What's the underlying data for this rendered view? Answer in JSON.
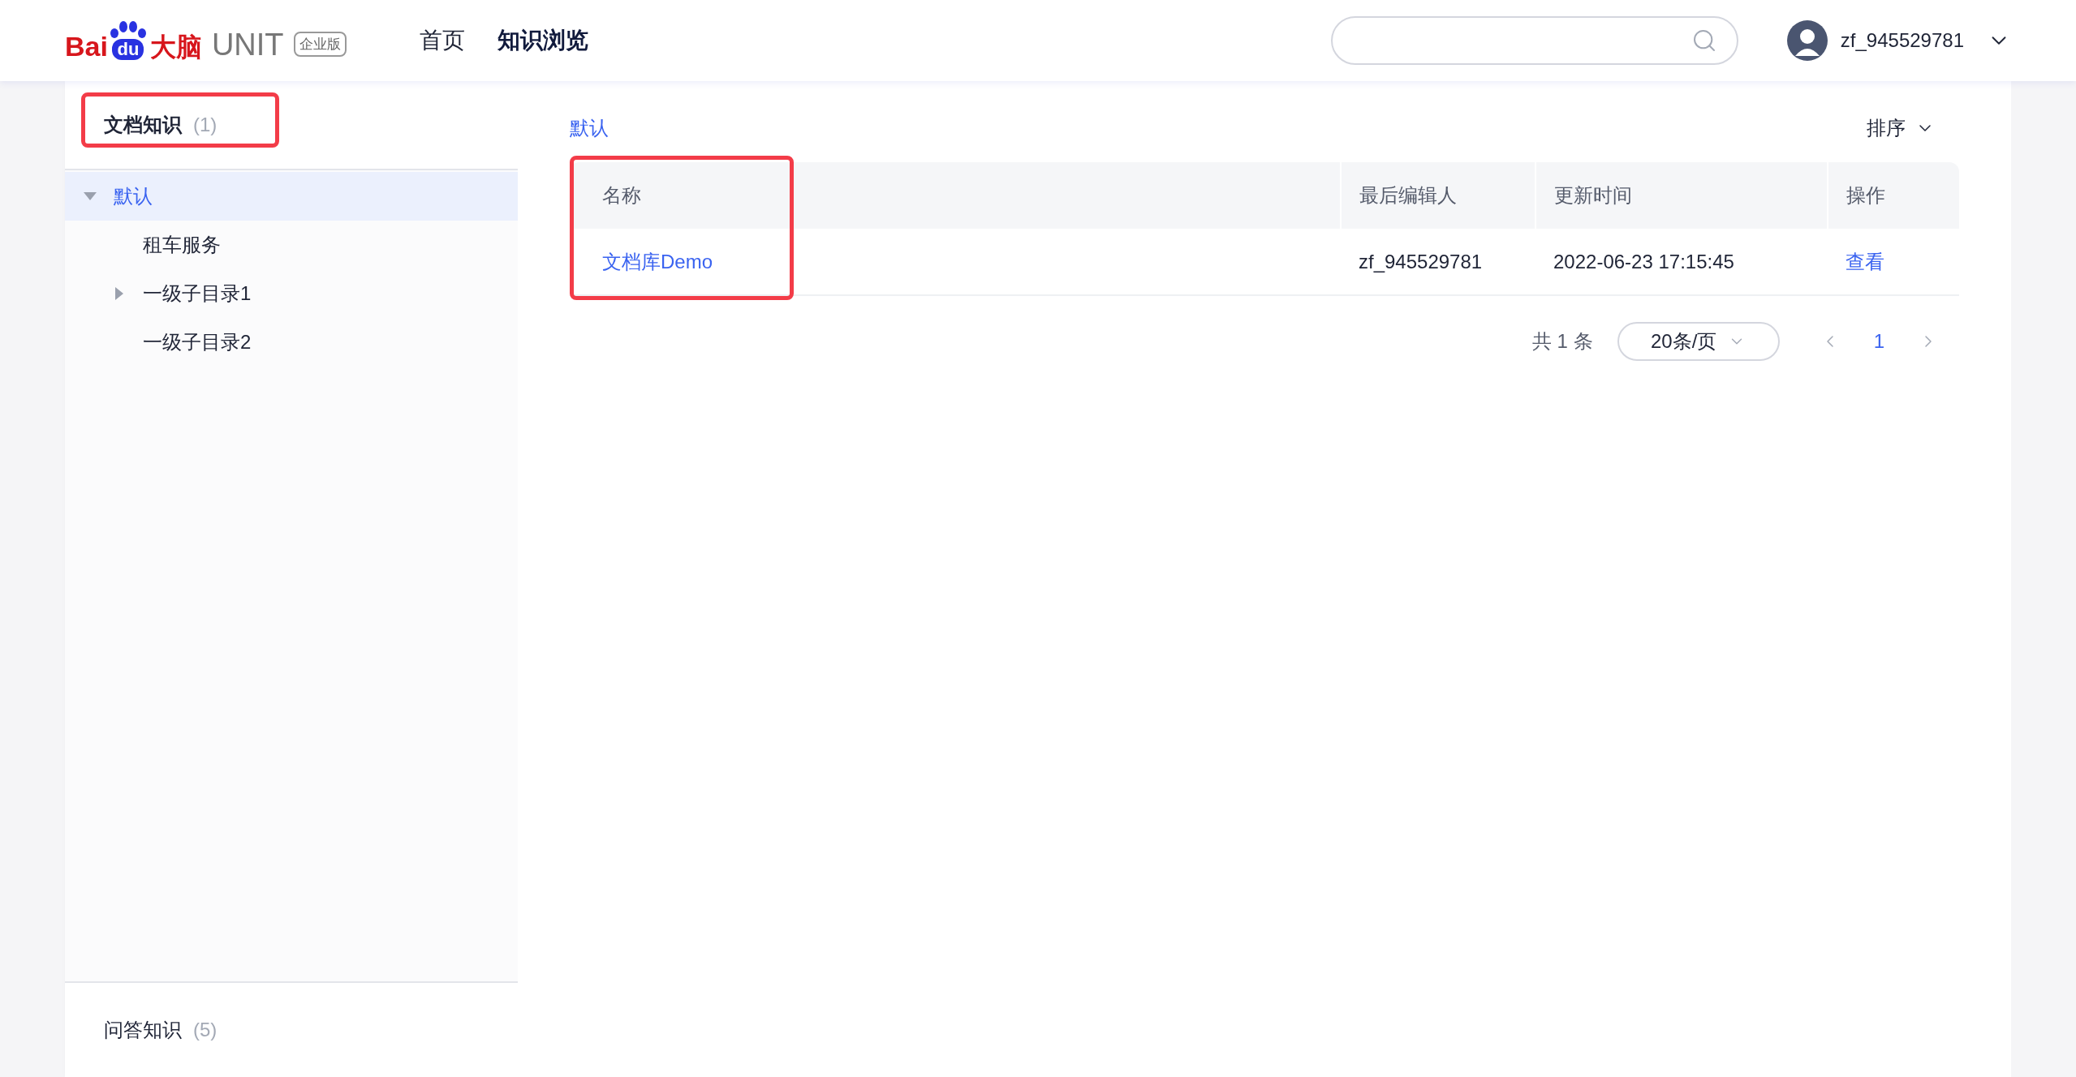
{
  "logo": {
    "brand_left": "Bai",
    "brand_paw": "du",
    "brand_right": "大脑",
    "product": "UNIT",
    "edition": "企业版"
  },
  "nav": [
    {
      "label": "首页",
      "selected": false
    },
    {
      "label": "知识浏览",
      "selected": true
    }
  ],
  "search": {
    "kind": "pill"
  },
  "user": {
    "name": "zf_945529781"
  },
  "sidebar": {
    "sections": [
      {
        "title": "文档知识",
        "count": "(1)",
        "selected": true
      },
      {
        "title": "问答知识",
        "count": "(5)",
        "selected": false
      }
    ],
    "tree": [
      {
        "label": "默认",
        "kind": "branch",
        "expanded": true,
        "selected": true,
        "children": [
          {
            "label": "租车服务",
            "kind": "leaf",
            "selected": false
          },
          {
            "label": "一级子目录1",
            "kind": "branch",
            "expanded": false,
            "selected": false
          },
          {
            "label": "一级子目录2",
            "kind": "leaf",
            "selected": false
          }
        ]
      }
    ]
  },
  "breadcrumb": "默认",
  "sort": {
    "label": "排序"
  },
  "table": {
    "columns": [
      "名称",
      "最后编辑人",
      "更新时间",
      "操作"
    ],
    "rows": [
      {
        "name": "文档库Demo",
        "editor": "zf_945529781",
        "updated": "2022-06-23 17:15:45",
        "action": "查看"
      }
    ]
  },
  "pagination": {
    "total": "共 1 条",
    "page_size": "20条/页",
    "pages": [
      {
        "label": "1",
        "selected": true
      }
    ]
  }
}
